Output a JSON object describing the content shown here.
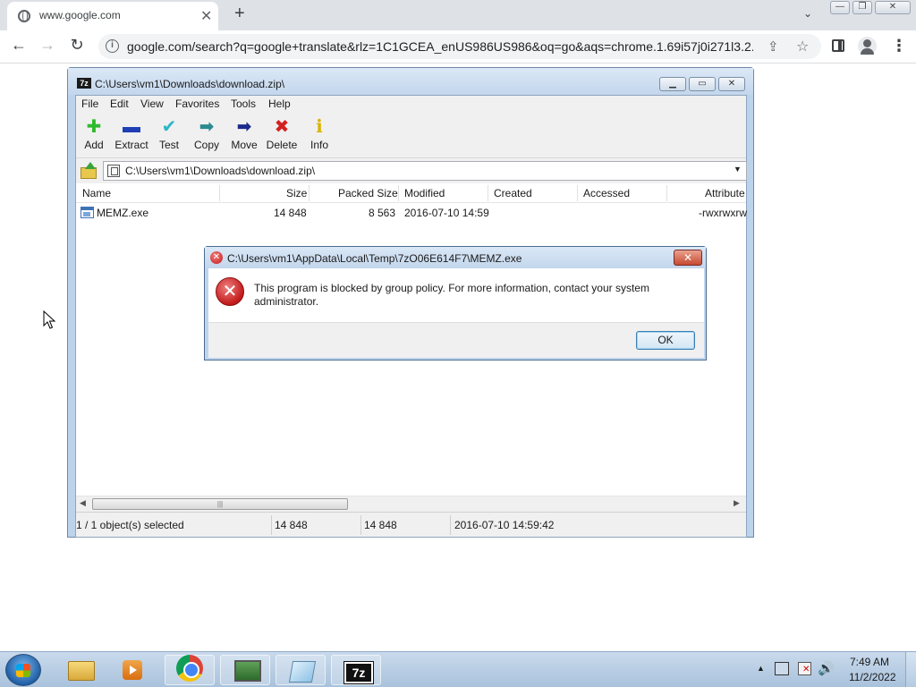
{
  "browser": {
    "tab_title": "www.google.com",
    "tab_close": "✕",
    "new_tab": "+",
    "tab_menu": "⌄",
    "url": "google.com/search?q=google+translate&rlz=1C1GCEA_enUS986US986&oq=go&aqs=chrome.1.69i57j0i271l3.2...",
    "nav_back": "←",
    "nav_forward": "→",
    "nav_reload": "↻",
    "info_glyph": "i",
    "share_glyph": "⇪",
    "star_glyph": "☆",
    "menu_glyph": "⋮",
    "window_controls": {
      "minimize": "—",
      "maximize": "❐",
      "close": "✕"
    }
  },
  "sevenzip": {
    "logo": "7z",
    "title": "C:\\Users\\vm1\\Downloads\\download.zip\\",
    "window_controls": {
      "minimize": "▁",
      "maximize": "▭",
      "close": "✕"
    },
    "menu": [
      "File",
      "Edit",
      "View",
      "Favorites",
      "Tools",
      "Help"
    ],
    "toolbar": [
      {
        "label": "Add",
        "icon": "add-icon",
        "glyph": "✚",
        "color": "#2dbb2d"
      },
      {
        "label": "Extract",
        "icon": "extract-icon",
        "glyph": "▬",
        "color": "#1f3fb5"
      },
      {
        "label": "Test",
        "icon": "test-icon",
        "glyph": "✔",
        "color": "#29b6c8"
      },
      {
        "label": "Copy",
        "icon": "copy-icon",
        "glyph": "➡",
        "color": "#2a8a8f"
      },
      {
        "label": "Move",
        "icon": "move-icon",
        "glyph": "➡",
        "color": "#1b2a8c"
      },
      {
        "label": "Delete",
        "icon": "delete-icon",
        "glyph": "✖",
        "color": "#d42020"
      },
      {
        "label": "Info",
        "icon": "info-icon",
        "glyph": "ℹ",
        "color": "#d9b400"
      }
    ],
    "address": "C:\\Users\\vm1\\Downloads\\download.zip\\",
    "address_dropdown": "▼",
    "columns": [
      "Name",
      "Size",
      "Packed Size",
      "Modified",
      "Created",
      "Accessed",
      "Attribute"
    ],
    "rows": [
      {
        "name": "MEMZ.exe",
        "size": "14 848",
        "packed": "8 563",
        "modified": "2016-07-10 14:59",
        "created": "",
        "accessed": "",
        "attributes": "-rwxrwxrw"
      }
    ],
    "scroll_left": "◀",
    "scroll_right": "▶",
    "scroll_grip": "|||",
    "status": {
      "selected": "1 / 1 object(s) selected",
      "size": "14 848",
      "packed": "14 848",
      "modified": "2016-07-10 14:59:42"
    }
  },
  "error_dialog": {
    "title": "C:\\Users\\vm1\\AppData\\Local\\Temp\\7zO06E614F7\\MEMZ.exe",
    "title_icon_glyph": "✕",
    "close_glyph": "✕",
    "icon_glyph": "✕",
    "message": "This program is blocked by group policy. For more information, contact your system administrator.",
    "ok_label": "OK"
  },
  "taskbar": {
    "apps": [
      {
        "name": "Windows Explorer",
        "icon": "explorer-icon"
      },
      {
        "name": "Windows Media Player",
        "icon": "media-player-icon"
      },
      {
        "name": "Google Chrome",
        "icon": "chrome-icon"
      },
      {
        "name": "Task Manager",
        "icon": "monitor-icon"
      },
      {
        "name": "Notepad",
        "icon": "notes-icon"
      },
      {
        "name": "7-Zip File Manager",
        "icon": "7zip-icon"
      }
    ],
    "tray_arrow": "▲",
    "volume_glyph": "🔊",
    "clock_time": "7:49 AM",
    "clock_date": "11/2/2022"
  }
}
